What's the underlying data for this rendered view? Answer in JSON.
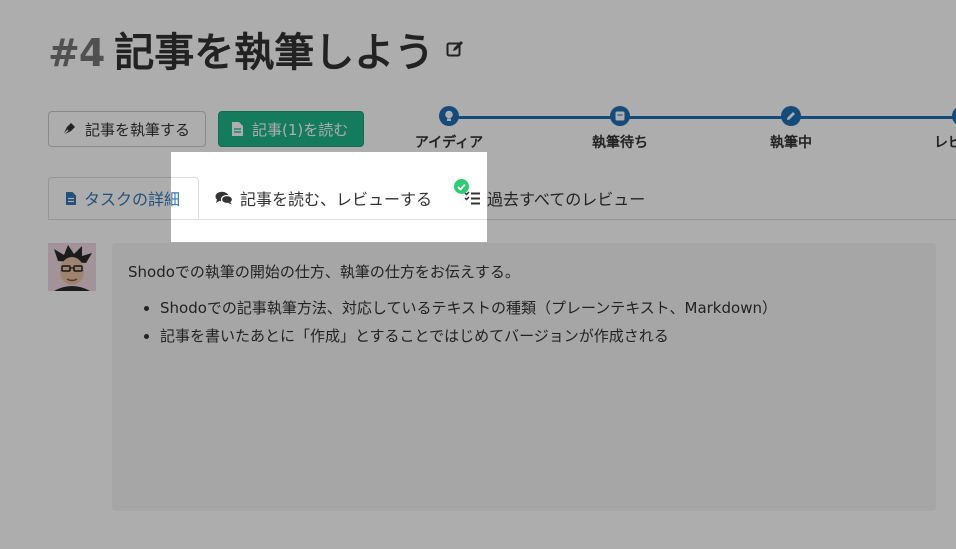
{
  "header": {
    "issue_number": "#4",
    "title": "記事を執筆しよう"
  },
  "actions": {
    "write_label": "記事を執筆する",
    "read_label": "記事(1)を読む"
  },
  "workflow": {
    "steps": [
      {
        "label": "アイディア",
        "icon": "lightbulb-icon"
      },
      {
        "label": "執筆待ち",
        "icon": "note-icon"
      },
      {
        "label": "執筆中",
        "icon": "pencil-icon"
      },
      {
        "label": "レビュー",
        "icon": "review-icon"
      }
    ]
  },
  "tabs": {
    "details": "タスクの詳細",
    "review": "記事を読む、レビューする",
    "past_reviews": "過去すべてのレビュー"
  },
  "description": {
    "lead": "Shodoでの執筆の開始の仕方、執筆の仕方をお伝えする。",
    "items": [
      "Shodoでの記事執筆方法、対応しているテキストの種類（プレーンテキスト、Markdown）",
      "記事を書いたあとに「作成」とすることではじめてバージョンが作成される"
    ]
  },
  "colors": {
    "accent_blue": "#1e6fb5",
    "success_green": "#1fb58a",
    "link_blue": "#337ab7"
  }
}
